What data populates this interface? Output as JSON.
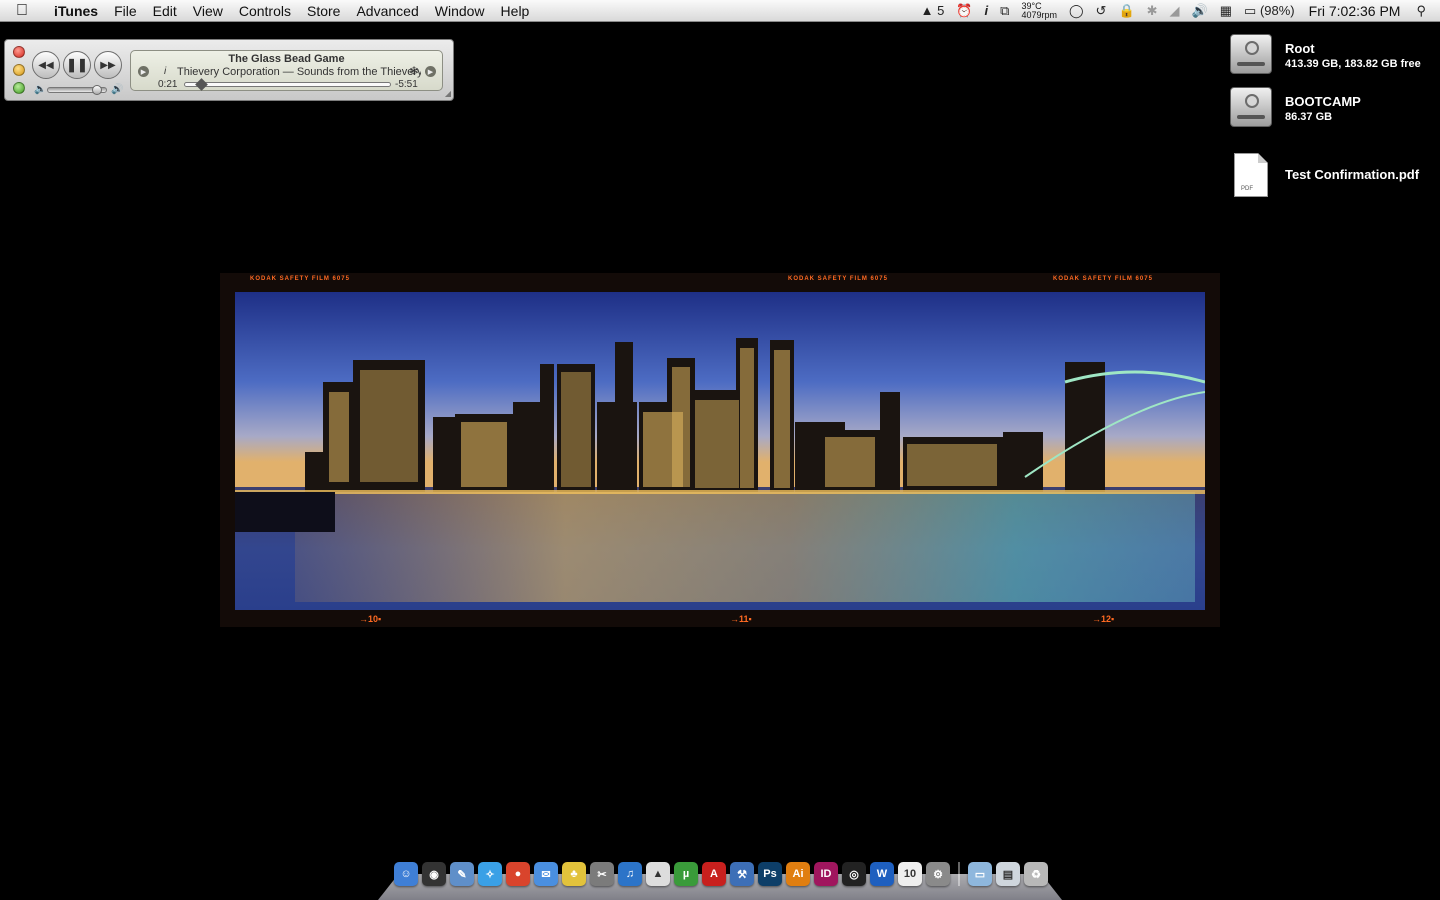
{
  "menubar": {
    "app_name": "iTunes",
    "items": [
      "File",
      "Edit",
      "View",
      "Controls",
      "Store",
      "Advanced",
      "Window",
      "Help"
    ],
    "status": {
      "adobe_updates": "5",
      "info_glyph": "i",
      "temperature": "39°C",
      "fan_speed": "4079rpm",
      "battery": "(98%)",
      "clock": "Fri 7:02:36 PM"
    }
  },
  "mini_player": {
    "song": "The Glass Bead Game",
    "artist_album": "Thievery Corporation — Sounds from the Thievery Hi-Fi",
    "info_glyph": "i",
    "elapsed": "0:21",
    "remaining": "-5:51",
    "progress": 0.06,
    "volume": 0.85
  },
  "desktop": {
    "drives": [
      {
        "name": "Root",
        "detail": "413.39 GB, 183.82 GB free"
      },
      {
        "name": "BOOTCAMP",
        "detail": "86.37 GB"
      }
    ],
    "file": {
      "name": "Test Confirmation.pdf",
      "type_label": "PDF"
    }
  },
  "wallpaper": {
    "film_marks": [
      "KODAK SAFETY FILM 6075",
      "KODAK SAFETY FILM 6075",
      "KODAK SAFETY FILM 6075"
    ],
    "frame_numbers": [
      "→10▪",
      "→11▪",
      "→12▪"
    ]
  },
  "dock": {
    "apps": [
      {
        "name": "finder-icon",
        "color": "#3f7fd6",
        "glyph": "☺"
      },
      {
        "name": "dashboard-icon",
        "color": "#333333",
        "glyph": "◉"
      },
      {
        "name": "preview-icon",
        "color": "#5f8fc9",
        "glyph": "✎"
      },
      {
        "name": "safari-icon",
        "color": "#3aa0e6",
        "glyph": "✧"
      },
      {
        "name": "chrome-icon",
        "color": "#d9442c",
        "glyph": "●"
      },
      {
        "name": "ichat-icon",
        "color": "#4a8fe0",
        "glyph": "✉"
      },
      {
        "name": "adium-icon",
        "color": "#e2c23b",
        "glyph": "♣"
      },
      {
        "name": "script-editor-icon",
        "color": "#7b7b7b",
        "glyph": "✂"
      },
      {
        "name": "itunes-icon",
        "color": "#2c74c8",
        "glyph": "♫"
      },
      {
        "name": "vlc-icon",
        "color": "#dddddd",
        "glyph": "▲"
      },
      {
        "name": "utorrent-icon",
        "color": "#3a9b3a",
        "glyph": "µ"
      },
      {
        "name": "acrobat-icon",
        "color": "#c8201e",
        "glyph": "A"
      },
      {
        "name": "xcode-icon",
        "color": "#3d6fb7",
        "glyph": "⚒"
      },
      {
        "name": "photoshop-icon",
        "color": "#0d3e68",
        "glyph": "Ps"
      },
      {
        "name": "illustrator-icon",
        "color": "#e07e10",
        "glyph": "Ai"
      },
      {
        "name": "indesign-icon",
        "color": "#a0165e",
        "glyph": "ID"
      },
      {
        "name": "aperture-icon",
        "color": "#222222",
        "glyph": "◎"
      },
      {
        "name": "word-icon",
        "color": "#1e5fbf",
        "glyph": "W"
      },
      {
        "name": "ical-icon",
        "color": "#eeeeee",
        "glyph": "10"
      },
      {
        "name": "system-preferences-icon",
        "color": "#8a8a8a",
        "glyph": "⚙"
      }
    ],
    "docs": [
      {
        "name": "applications-folder-icon",
        "color": "#8eb7dd",
        "glyph": "▭"
      },
      {
        "name": "downloads-stack-icon",
        "color": "#cfd6dd",
        "glyph": "▤"
      },
      {
        "name": "trash-icon",
        "color": "#b8b8b8",
        "glyph": "♻"
      }
    ]
  }
}
